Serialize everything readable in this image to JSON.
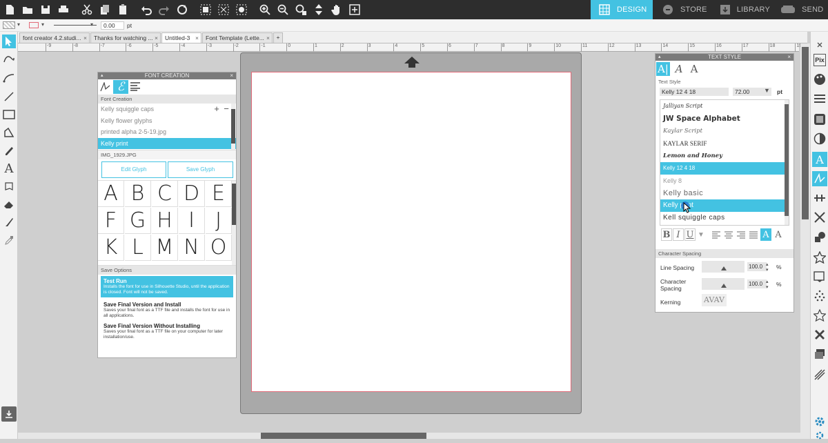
{
  "nav": {
    "design": "DESIGN",
    "store": "STORE",
    "library": "LIBRARY",
    "send": "SEND"
  },
  "propbar": {
    "line_width": "0.00",
    "unit": "pt"
  },
  "tabs": [
    {
      "label": "font creator 4.2.studi..."
    },
    {
      "label": "Thanks for watching ..."
    },
    {
      "label": "Untitled-3"
    },
    {
      "label": "Font Template (Lette..."
    }
  ],
  "ruler": {
    "labels": [
      "-9",
      "-8",
      "-7",
      "-6",
      "-5",
      "-4",
      "-3",
      "-2",
      "-1",
      "0",
      "1",
      "2",
      "3",
      "4",
      "5",
      "6",
      "7",
      "8",
      "9",
      "10",
      "11",
      "12",
      "13",
      "14",
      "15",
      "16",
      "17",
      "18",
      "19",
      "20"
    ]
  },
  "font_creation": {
    "title": "FONT CREATION",
    "section_label": "Font Creation",
    "fonts": [
      "Kelly squiggle caps",
      "Kelly flower glyphs",
      "printed alpha 2-5-19.jpg",
      "Kelly print"
    ],
    "selected_font": "Kelly print",
    "image_name": "IMG_1929.JPG",
    "edit_glyph": "Edit Glyph",
    "save_glyph": "Save Glyph",
    "glyphs": [
      "A",
      "B",
      "C",
      "D",
      "E",
      "F",
      "G",
      "H",
      "I",
      "J",
      "K",
      "L",
      "M",
      "N",
      "O"
    ],
    "save_options_label": "Save Options",
    "options": [
      {
        "title": "Test Run",
        "desc": "Installs the font for use in Silhouette Studio, until the application is closed. Font will not be saved."
      },
      {
        "title": "Save Final Version and Install",
        "desc": "Saves your final font as a TTF file and installs the font for use in all applications."
      },
      {
        "title": "Save Final Version Without Installing",
        "desc": "Saves your final font as a TTF file on your computer for later installation/use."
      }
    ]
  },
  "text_style": {
    "title": "TEXT STYLE",
    "section_label": "Text Style",
    "font_name": "Kelly 12 4 18",
    "font_size": "72.00",
    "unit": "pt",
    "fonts": [
      "Jalliyan Script",
      "JW Space Alphabet",
      "Kaylar Script",
      "KAYLAR SERIF",
      "Lemon and Honey",
      "Kelly 12 4 18",
      "Kelly 8",
      "Kelly basic",
      "Kelly print",
      "Kell squiggle caps"
    ],
    "char_spacing_label": "Character Spacing",
    "line_spacing_label": "Line Spacing",
    "line_spacing_value": "100.0",
    "character_spacing_label": "Character Spacing",
    "character_spacing_value": "100.0",
    "percent": "%",
    "kerning_label": "Kerning",
    "kerning_sample": "AVAV"
  },
  "colors": {
    "accent": "#43c2e2",
    "toolbar": "#2d2d2d",
    "mat": "#a9a9a9",
    "cut_border": "#e26a78"
  }
}
